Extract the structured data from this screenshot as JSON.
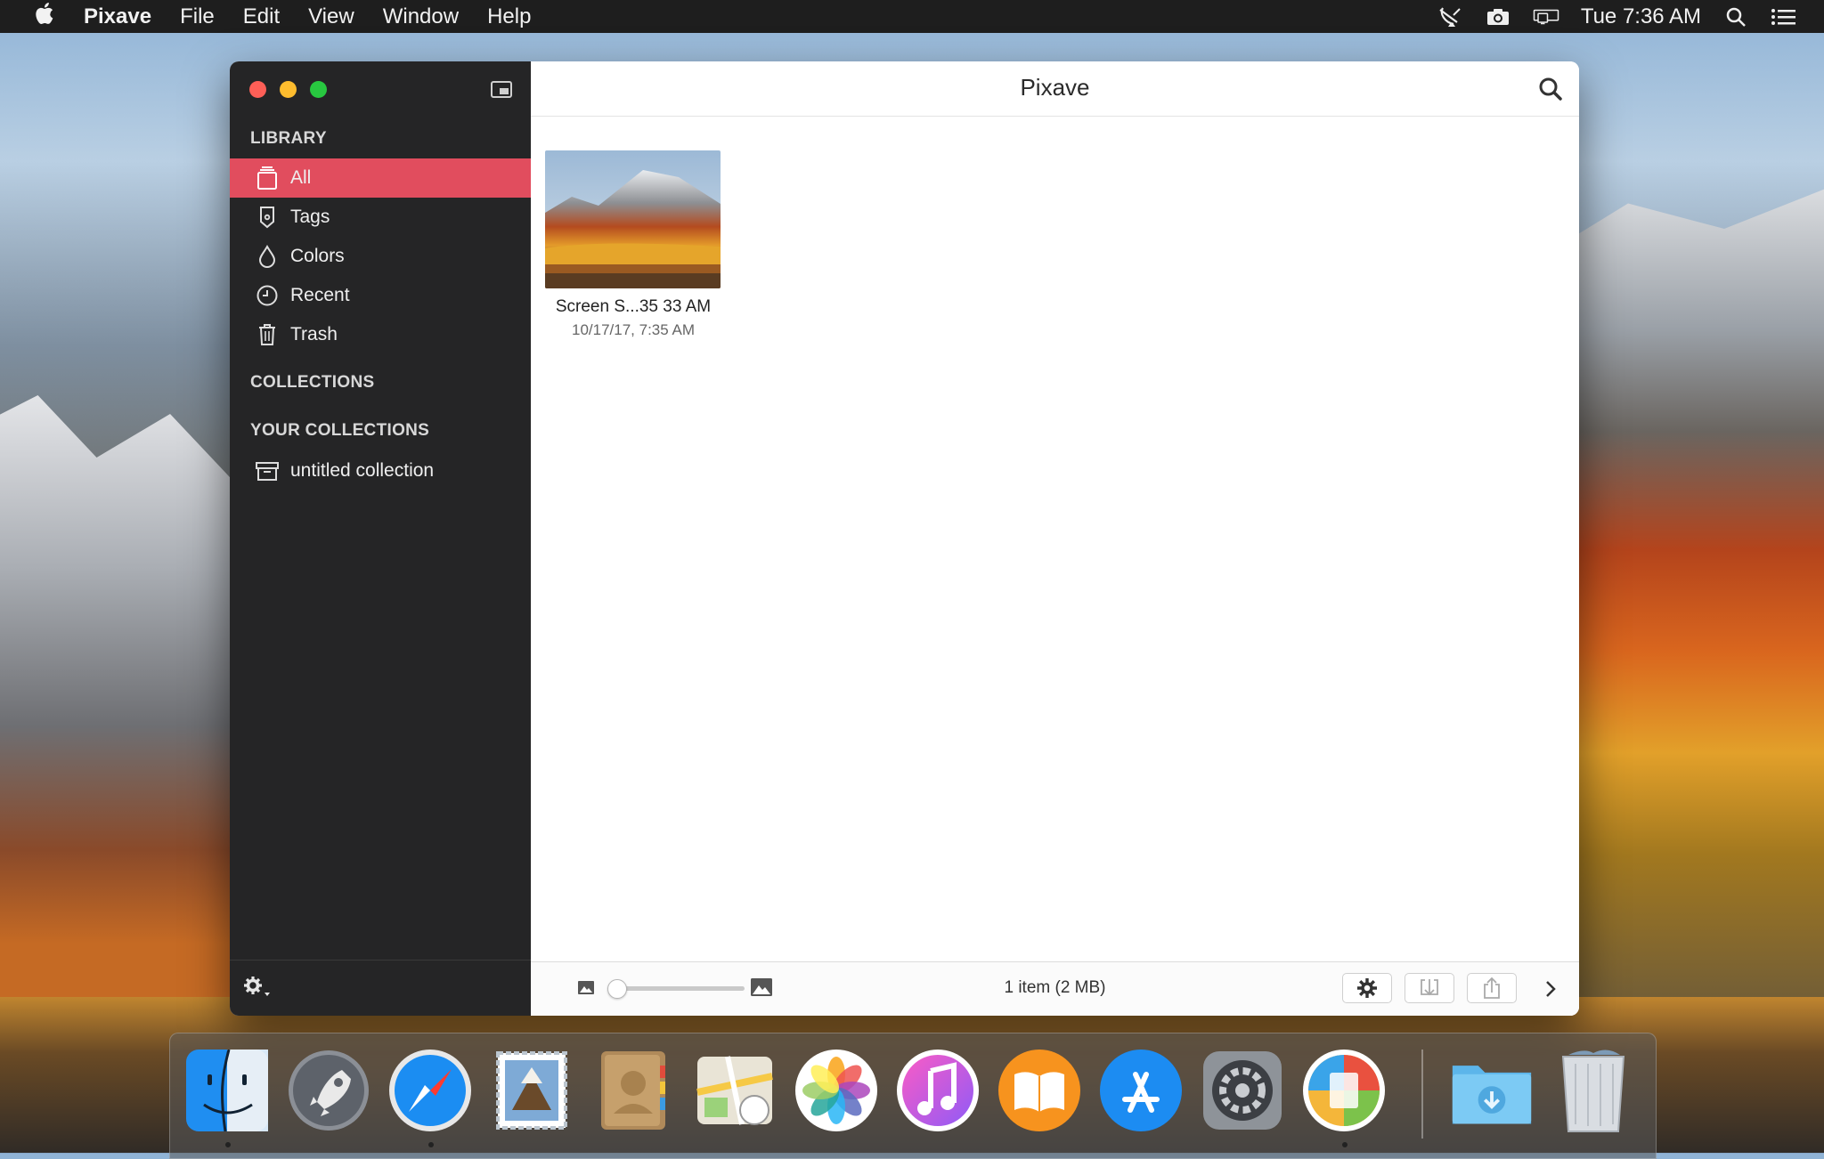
{
  "menubar": {
    "app_name": "Pixave",
    "menus": [
      "File",
      "Edit",
      "View",
      "Window",
      "Help"
    ],
    "clock": "Tue 7:36 AM"
  },
  "window": {
    "title": "Pixave",
    "sidebar": {
      "library_header": "LIBRARY",
      "library_items": [
        {
          "label": "All",
          "icon": "all-icon",
          "active": true
        },
        {
          "label": "Tags",
          "icon": "tag-icon"
        },
        {
          "label": "Colors",
          "icon": "drop-icon"
        },
        {
          "label": "Recent",
          "icon": "clock-icon"
        },
        {
          "label": "Trash",
          "icon": "trash-icon"
        }
      ],
      "collections_header": "COLLECTIONS",
      "your_collections_header": "YOUR COLLECTIONS",
      "your_collections": [
        {
          "label": "untitled collection",
          "icon": "archive-box-icon"
        }
      ]
    },
    "grid": {
      "items": [
        {
          "name": "Screen S...35 33 AM",
          "date": "10/17/17, 7:35 AM"
        }
      ]
    },
    "bottombar": {
      "status": "1 item (2 MB)",
      "zoom_level": 0.0
    }
  },
  "dock": {
    "apps": [
      "Finder",
      "Launchpad",
      "Safari",
      "Mail",
      "Contacts",
      "Maps",
      "Photos",
      "iTunes",
      "iBooks",
      "App Store",
      "System Preferences",
      "Pixave",
      "Downloads",
      "Trash"
    ]
  },
  "colors": {
    "accent": "#e14d5e",
    "sidebar_bg": "#252526",
    "menubar_bg": "#1e1e1e"
  }
}
